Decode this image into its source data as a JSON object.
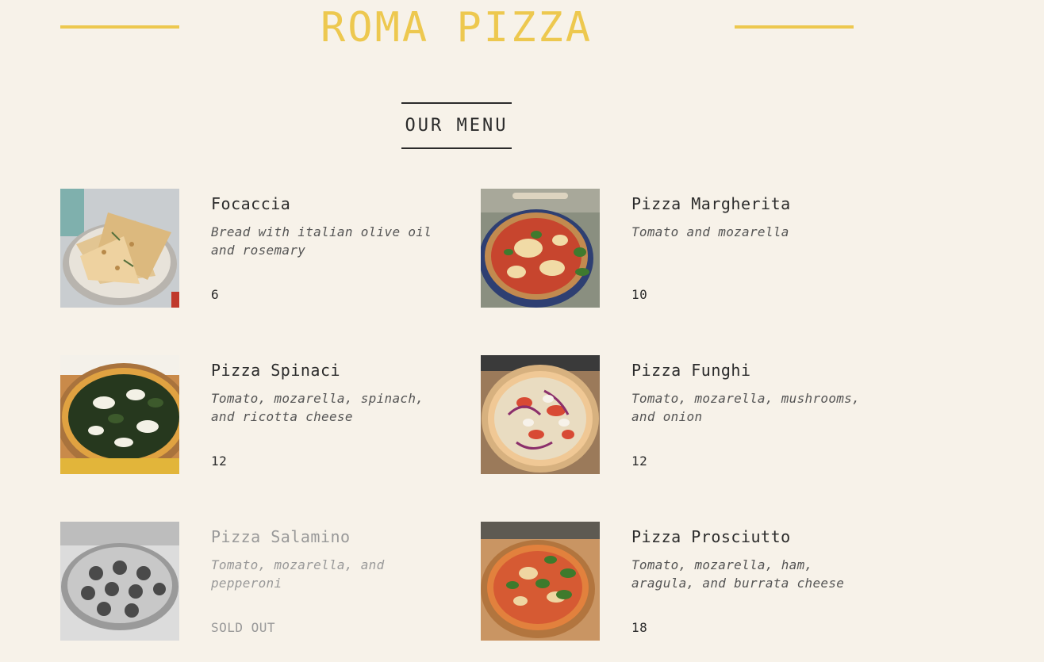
{
  "header": {
    "brand": "ROMA PIZZA",
    "accent_color": "#edc84f"
  },
  "menu": {
    "heading": "OUR MENU",
    "items": [
      {
        "name": "Focaccia",
        "description": "Bread with italian olive oil and rosemary",
        "price": "6",
        "sold_out": false
      },
      {
        "name": "Pizza Margherita",
        "description": "Tomato and mozarella",
        "price": "10",
        "sold_out": false
      },
      {
        "name": "Pizza Spinaci",
        "description": "Tomato, mozarella, spinach, and ricotta cheese",
        "price": "12",
        "sold_out": false
      },
      {
        "name": "Pizza Funghi",
        "description": "Tomato, mozarella, mushrooms, and onion",
        "price": "12",
        "sold_out": false
      },
      {
        "name": "Pizza Salamino",
        "description": "Tomato, mozarella, and pepperoni",
        "price": "SOLD OUT",
        "sold_out": true
      },
      {
        "name": "Pizza Prosciutto",
        "description": "Tomato, mozarella, ham, aragula, and burrata cheese",
        "price": "18",
        "sold_out": false
      }
    ]
  }
}
